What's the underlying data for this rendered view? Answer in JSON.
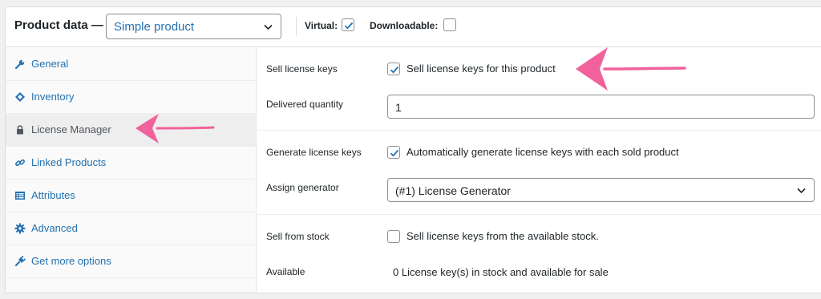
{
  "header": {
    "title": "Product data —",
    "product_type": "Simple product",
    "virtual_label": "Virtual:",
    "virtual_checked": true,
    "downloadable_label": "Downloadable:",
    "downloadable_checked": false
  },
  "sidebar": {
    "items": [
      {
        "label": "General",
        "icon": "wrench-icon"
      },
      {
        "label": "Inventory",
        "icon": "tag-icon"
      },
      {
        "label": "License Manager",
        "icon": "lock-icon",
        "active": true
      },
      {
        "label": "Linked Products",
        "icon": "link-icon"
      },
      {
        "label": "Attributes",
        "icon": "list-icon"
      },
      {
        "label": "Advanced",
        "icon": "gear-icon"
      },
      {
        "label": "Get more options",
        "icon": "plugin-icon"
      }
    ]
  },
  "license": {
    "sell_label": "Sell license keys",
    "sell_checkbox_text": "Sell license keys for this product",
    "sell_checked": true,
    "delivered_label": "Delivered quantity",
    "delivered_value": "1",
    "generate_label": "Generate license keys",
    "generate_checkbox_text": "Automatically generate license keys with each sold product",
    "generate_checked": true,
    "assign_label": "Assign generator",
    "assign_value": "(#1) License Generator",
    "stock_label": "Sell from stock",
    "stock_checkbox_text": "Sell license keys from the available stock.",
    "stock_checked": false,
    "available_label": "Available",
    "available_text": "0 License key(s) in stock and available for sale"
  },
  "colors": {
    "accent": "#2271b1",
    "annotation_arrow": "#f1619b"
  }
}
